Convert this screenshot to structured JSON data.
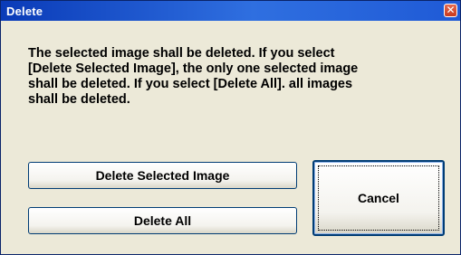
{
  "window": {
    "title": "Delete",
    "close_glyph": "✕",
    "titlebar_color": "#2f6fe0",
    "body_color": "#ece9d8"
  },
  "dialog": {
    "message_lines": [
      "The selected image shall be  deleted. If you select",
      "[Delete Selected Image], the only one selected image",
      "shall be deleted. If you select [Delete All]. all images",
      "shall be deleted."
    ]
  },
  "buttons": {
    "delete_selected_label": "Delete Selected Image",
    "delete_all_label": "Delete All",
    "cancel_label": "Cancel"
  },
  "icons": {
    "close": "close-icon"
  }
}
